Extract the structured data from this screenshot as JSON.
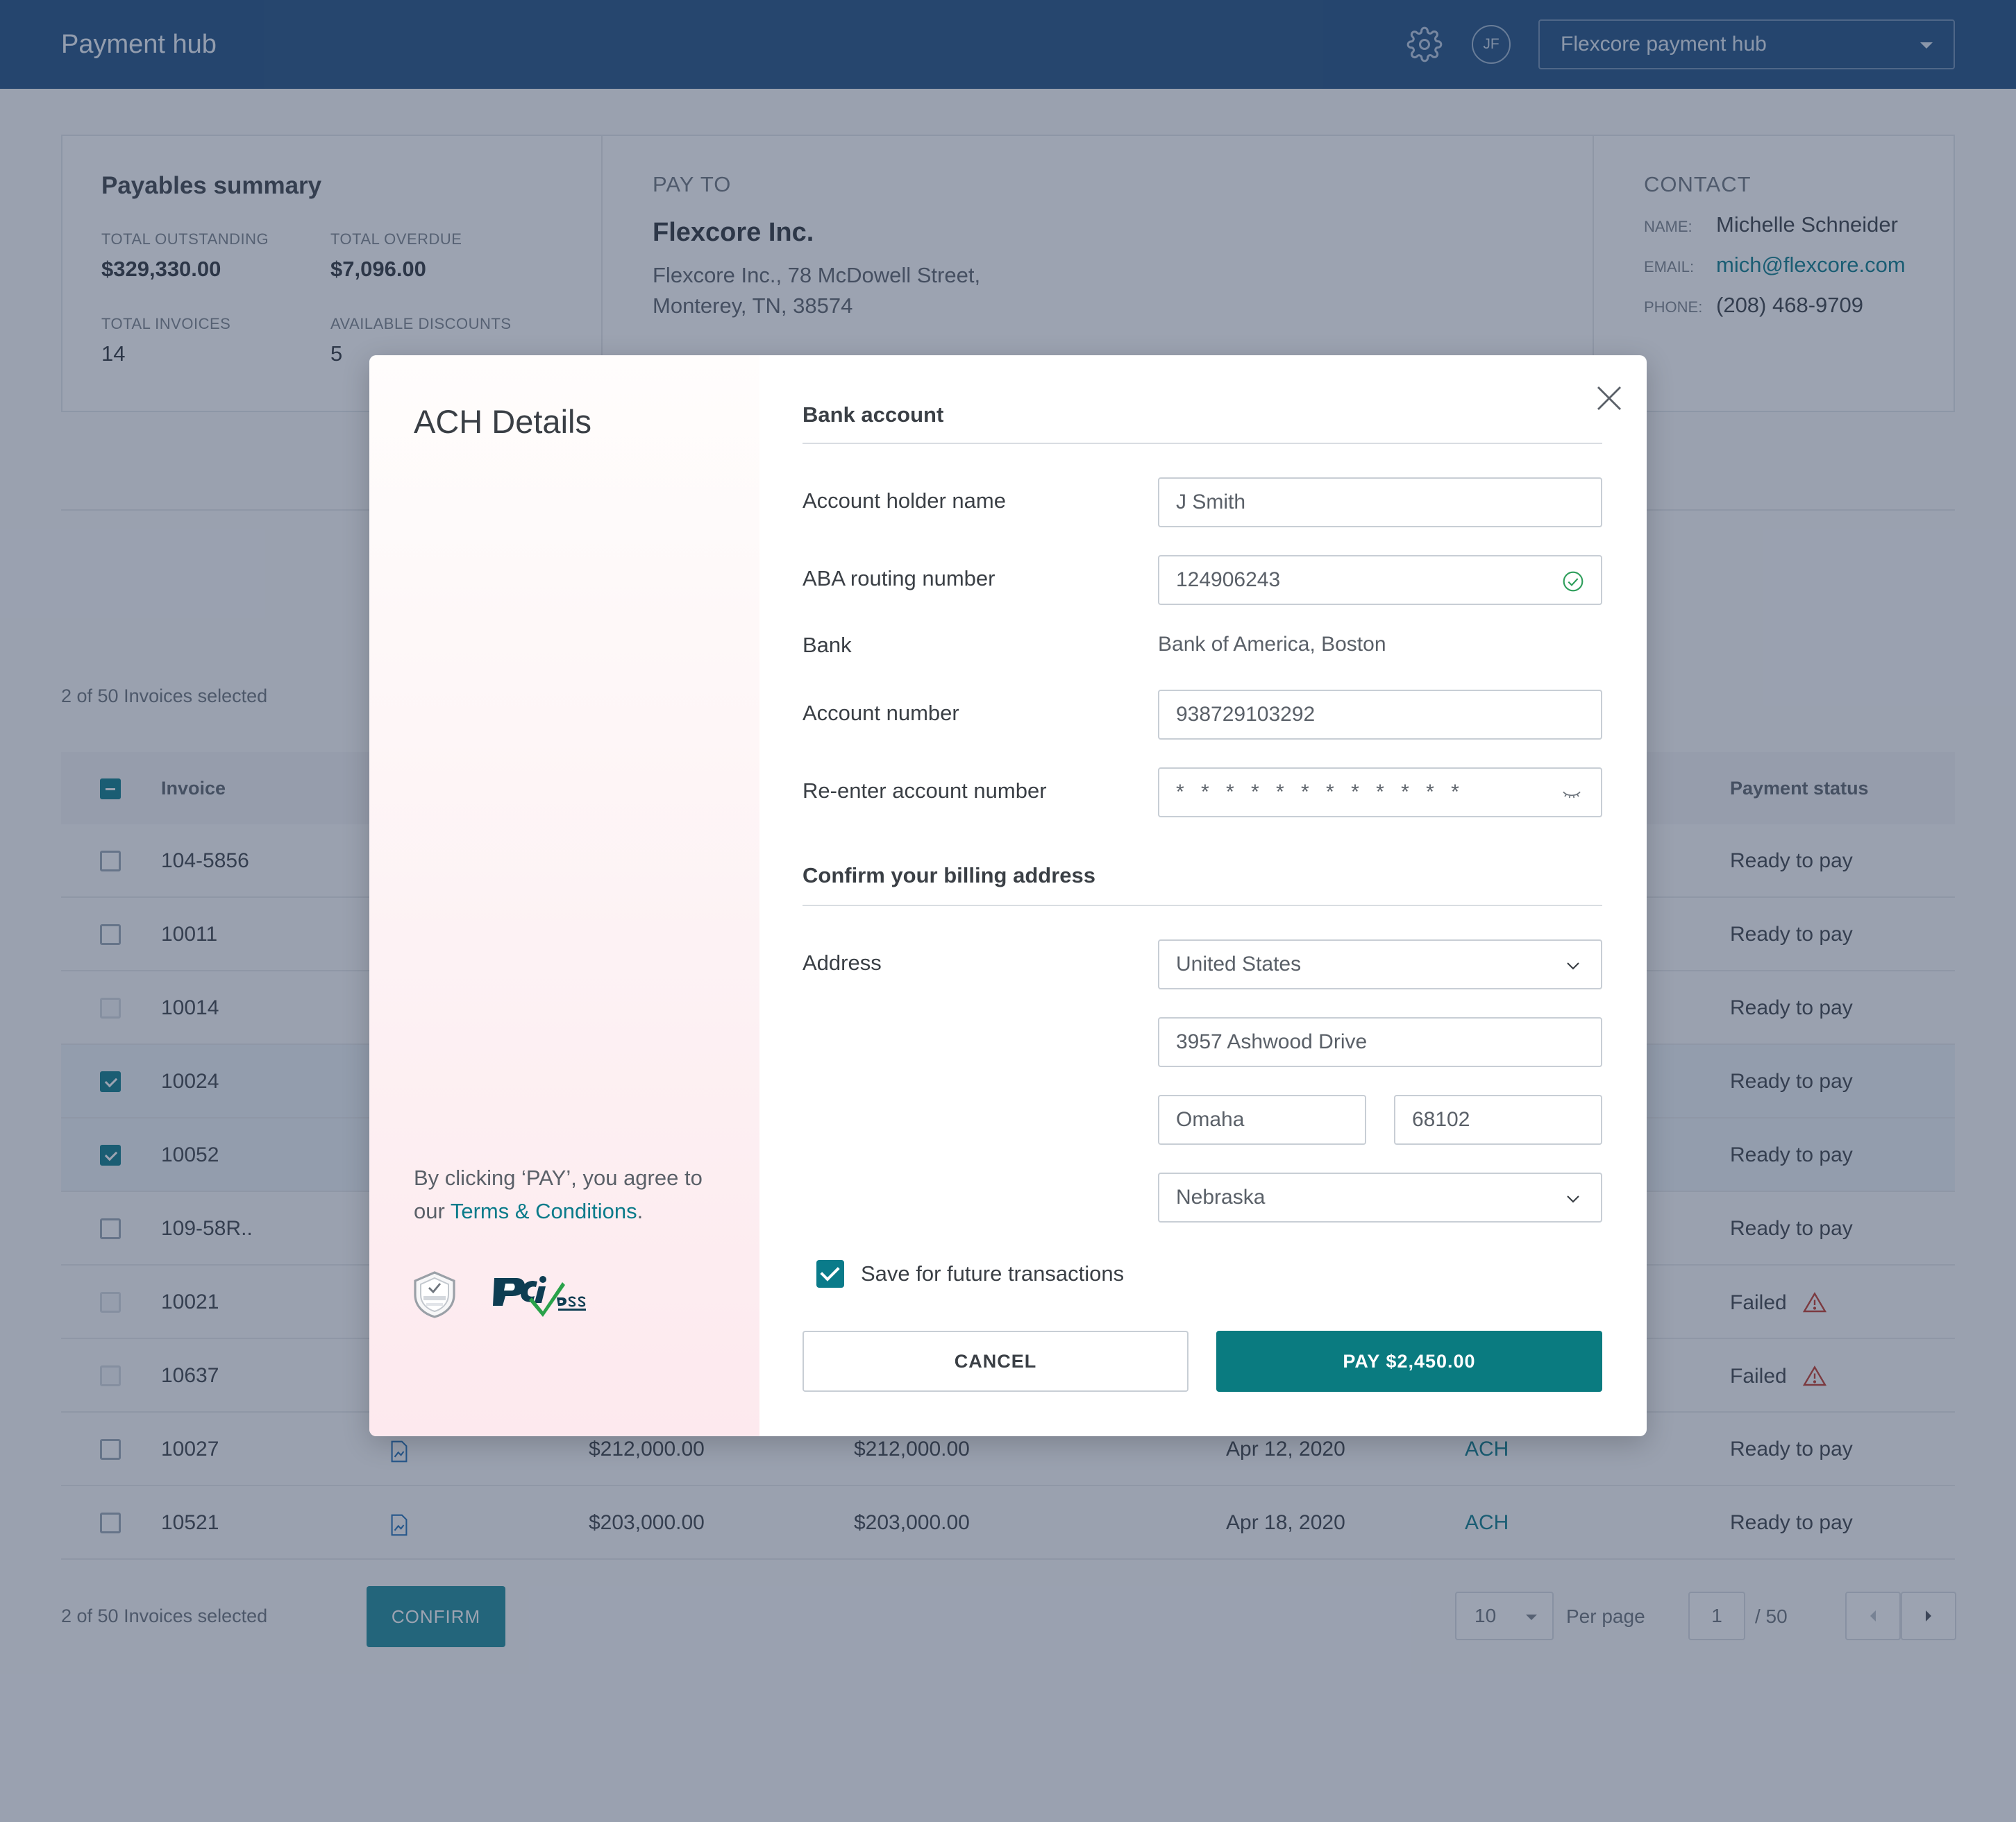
{
  "header": {
    "title": "Payment hub",
    "avatar_initials": "JF",
    "hub_select_value": "Flexcore payment hub"
  },
  "summary": {
    "title": "Payables summary",
    "total_outstanding_label": "TOTAL OUTSTANDING",
    "total_outstanding": "$329,330.00",
    "total_overdue_label": "TOTAL OVERDUE",
    "total_overdue": "$7,096.00",
    "total_invoices_label": "TOTAL INVOICES",
    "total_invoices": "14",
    "available_discounts_label": "AVAILABLE DISCOUNTS",
    "available_discounts": "5"
  },
  "pay_to": {
    "caption": "PAY TO",
    "name": "Flexcore Inc.",
    "address": "Flexcore Inc., 78 McDowell Street, Monterey, TN, 38574"
  },
  "contact": {
    "caption": "CONTACT",
    "name_label": "NAME:",
    "name": "Michelle Schneider",
    "email_label": "EMAIL:",
    "email": "mich@flexcore.com",
    "phone_label": "PHONE:",
    "phone": "(208) 468-9709"
  },
  "table": {
    "selected_text": "2 of 50 Invoices selected",
    "header_invoice": "Invoice",
    "header_status": "Payment status",
    "rows": [
      {
        "invoice": "104-5856",
        "status": "Ready to pay"
      },
      {
        "invoice": "10011",
        "status": "Ready to pay"
      },
      {
        "invoice": "10014",
        "status": "Ready to pay"
      },
      {
        "invoice": "10024",
        "status": "Ready to pay"
      },
      {
        "invoice": "10052",
        "status": "Ready to pay"
      },
      {
        "invoice": "109-58R..",
        "status": "Ready to pay"
      },
      {
        "invoice": "10021",
        "status": "Failed"
      },
      {
        "invoice": "10637",
        "status": "Failed"
      },
      {
        "invoice": "10027",
        "amount": "$212,000.00",
        "open": "$212,000.00",
        "date": "Apr 12, 2020",
        "method": "ACH",
        "status": "Ready to pay"
      },
      {
        "invoice": "10521",
        "amount": "$203,000.00",
        "open": "$203,000.00",
        "date": "Apr 18, 2020",
        "method": "ACH",
        "status": "Ready to pay"
      }
    ]
  },
  "footer": {
    "selected_text": "2 of 50 Invoices selected",
    "confirm_label": "CONFIRM",
    "per_page_value": "10",
    "per_page_label": "Per page",
    "page_value": "1",
    "page_total": "/ 50"
  },
  "modal": {
    "title": "ACH Details",
    "agree_prefix": "By clicking ‘PAY’, you agree to our ",
    "terms_link": "Terms & Conditions",
    "agree_suffix": ".",
    "bank_section": "Bank account",
    "account_holder_label": "Account holder name",
    "account_holder_value": "J Smith",
    "routing_label": "ABA routing number",
    "routing_value": "124906243",
    "bank_label": "Bank",
    "bank_value": "Bank of America, Boston",
    "account_number_label": "Account number",
    "account_number_value": "938729103292",
    "reenter_label": "Re-enter account number",
    "reenter_value": "* * * * * * * * * * * *",
    "billing_section": "Confirm your billing address",
    "address_label": "Address",
    "country_value": "United States",
    "street_value": "3957 Ashwood Drive",
    "city_value": "Omaha",
    "zip_value": "68102",
    "state_value": "Nebraska",
    "save_label": "Save for future transactions",
    "cancel_label": "CANCEL",
    "pay_label": "PAY $2,450.00"
  },
  "colors": {
    "brand_header": "#1f4f80",
    "accent_teal": "#0a7b80",
    "success_green": "#2e9e5b"
  }
}
